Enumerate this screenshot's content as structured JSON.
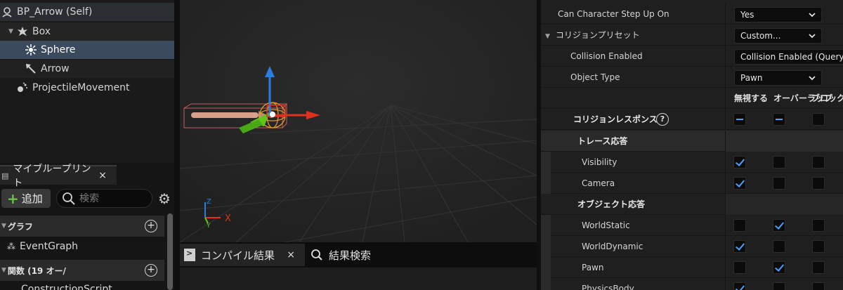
{
  "components": {
    "self": "BP_Arrow (Self)",
    "box": "Box",
    "sphere": "Sphere",
    "arrow": "Arrow",
    "projectile": "ProjectileMovement"
  },
  "my_blueprint": {
    "tab_label": "マイブループリント",
    "close": "×",
    "add_label": "追加",
    "search_placeholder": "検索",
    "sections": {
      "graph": "グラフ",
      "functions": "関数 (19 オー/"
    },
    "event_graph": "EventGraph",
    "construction_script": "ConstructionScript"
  },
  "bottom_tabs": {
    "compile_results": "コンパイル結果",
    "close": "×",
    "find_results": "結果検索"
  },
  "viewport": {
    "axis_x": "X",
    "axis_y": "Y",
    "axis_z": "Z"
  },
  "details": {
    "step_up_label": "Can Character Step Up On",
    "step_up_value": "Yes",
    "preset_label": "コリジョンプリセット",
    "preset_value": "Custom...",
    "collision_enabled_label": "Collision Enabled",
    "collision_enabled_value": "Collision Enabled (Query and",
    "object_type_label": "Object Type",
    "object_type_value": "Pawn",
    "col_ignore": "無視する",
    "col_overlap": "オーバーラップ",
    "col_block": "ブロック",
    "responses_label": "コリジョンレスポンス",
    "help": "?",
    "trace_section": "トレース応答",
    "object_section": "オブジェクト応答",
    "rows": [
      {
        "label": "Visibility",
        "ignore": true,
        "overlap": false,
        "block": false
      },
      {
        "label": "Camera",
        "ignore": true,
        "overlap": false,
        "block": false
      },
      {
        "label": "WorldStatic",
        "ignore": false,
        "overlap": true,
        "block": false
      },
      {
        "label": "WorldDynamic",
        "ignore": true,
        "overlap": false,
        "block": false
      },
      {
        "label": "Pawn",
        "ignore": false,
        "overlap": true,
        "block": false
      },
      {
        "label": "PhysicsBody",
        "ignore": true,
        "overlap": false,
        "block": false
      }
    ]
  },
  "colors": {
    "selected_row": "#3b4a5c",
    "checkbox_accent": "#4aa0ff",
    "add_plus": "#6cc24a",
    "axis_x": "#e0301e",
    "axis_y": "#5fc61c",
    "axis_z": "#2a7de1"
  }
}
